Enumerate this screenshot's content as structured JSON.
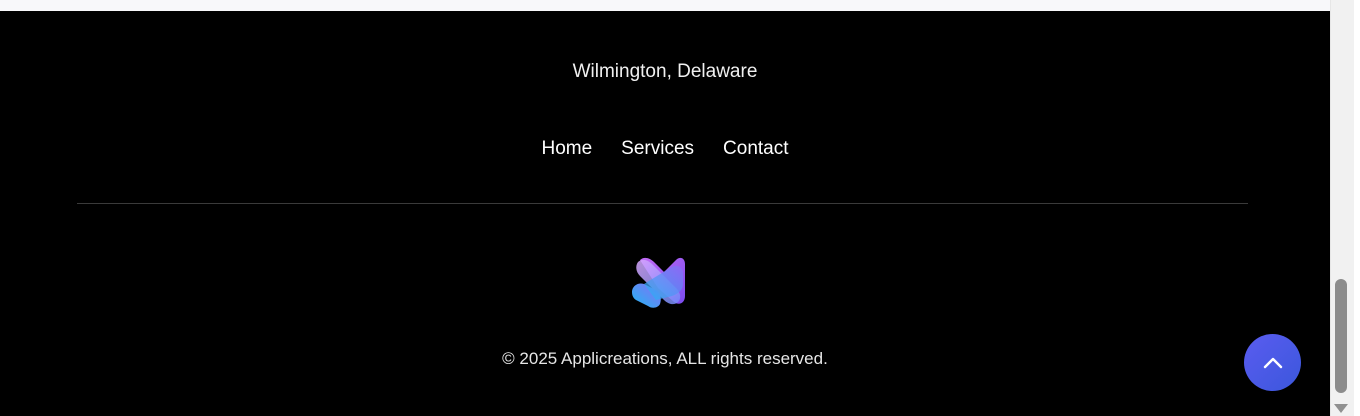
{
  "footer": {
    "location": "Wilmington, Delaware",
    "nav": [
      {
        "label": "Home"
      },
      {
        "label": "Services"
      },
      {
        "label": "Contact"
      }
    ],
    "logo_icon": "applicreations-logo-icon",
    "copyright": "© 2025 Applicreations, ALL rights reserved."
  },
  "scroll_top": {
    "icon": "chevron-up-icon",
    "color": "#4a5ae8"
  },
  "colors": {
    "footer_bg": "#000000",
    "text": "#ffffff"
  }
}
